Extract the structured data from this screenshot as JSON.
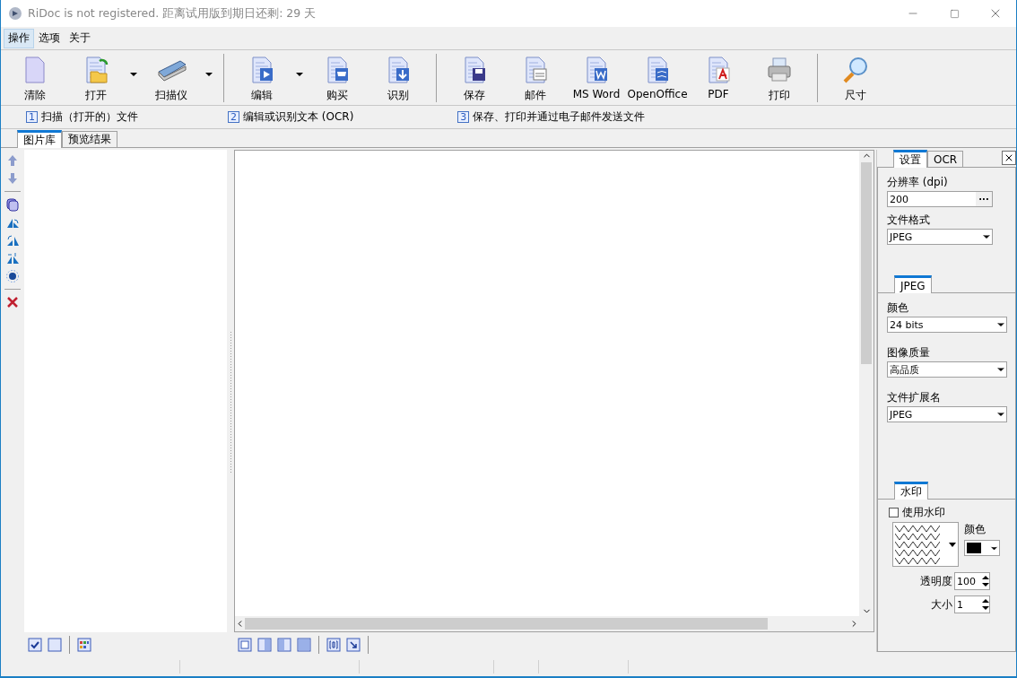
{
  "window": {
    "title": "RiDoc is not registered. 距离试用版到期日还剩:  29 天"
  },
  "menu": [
    {
      "label": "操作",
      "selected": true
    },
    {
      "label": "选项",
      "selected": false
    },
    {
      "label": "关于",
      "selected": false
    }
  ],
  "toolbar": {
    "groups": [
      [
        {
          "label": "清除",
          "has_menu": false
        },
        {
          "label": "打开",
          "has_menu": true
        },
        {
          "label": "扫描仪",
          "has_menu": true
        }
      ],
      [
        {
          "label": "编辑",
          "has_menu": true
        },
        {
          "label": "购买",
          "has_menu": false
        },
        {
          "label": "识别",
          "has_menu": false
        }
      ],
      [
        {
          "label": "保存",
          "has_menu": false
        },
        {
          "label": "邮件",
          "has_menu": false
        },
        {
          "label": "MS Word",
          "has_menu": false
        },
        {
          "label": "OpenOffice",
          "has_menu": false
        },
        {
          "label": "PDF",
          "has_menu": false
        },
        {
          "label": "打印",
          "has_menu": false
        }
      ],
      [
        {
          "label": "尺寸",
          "has_menu": false
        }
      ]
    ]
  },
  "steps": [
    {
      "number": "1",
      "text": "扫描（打开的）文件"
    },
    {
      "number": "2",
      "text": "编辑或识别文本 (OCR)"
    },
    {
      "number": "3",
      "text": "保存、打印并通过电子邮件发送文件"
    }
  ],
  "view_tabs": [
    {
      "label": "图片库",
      "selected": true
    },
    {
      "label": "预览结果",
      "selected": false
    }
  ],
  "settings_panel": {
    "tabs": [
      {
        "label": "设置",
        "selected": true
      },
      {
        "label": "OCR",
        "selected": false
      }
    ],
    "resolution": {
      "label": "分辨率 (dpi)",
      "value": "200",
      "button": "···"
    },
    "format": {
      "label": "文件格式",
      "value": "JPEG"
    },
    "jpeg": {
      "tab": "JPEG",
      "fields": [
        {
          "label": "颜色",
          "value": "24 bits"
        },
        {
          "label": "图像质量",
          "value": "高品质"
        },
        {
          "label": "文件扩展名",
          "value": "JPEG"
        }
      ]
    },
    "watermark": {
      "tab": "水印",
      "use_label": "使用水印",
      "checked": false,
      "color_label": "颜色",
      "color": "#000000",
      "opacity": {
        "label": "透明度",
        "value": "100"
      },
      "size": {
        "label": "大小",
        "value": "1"
      }
    }
  }
}
